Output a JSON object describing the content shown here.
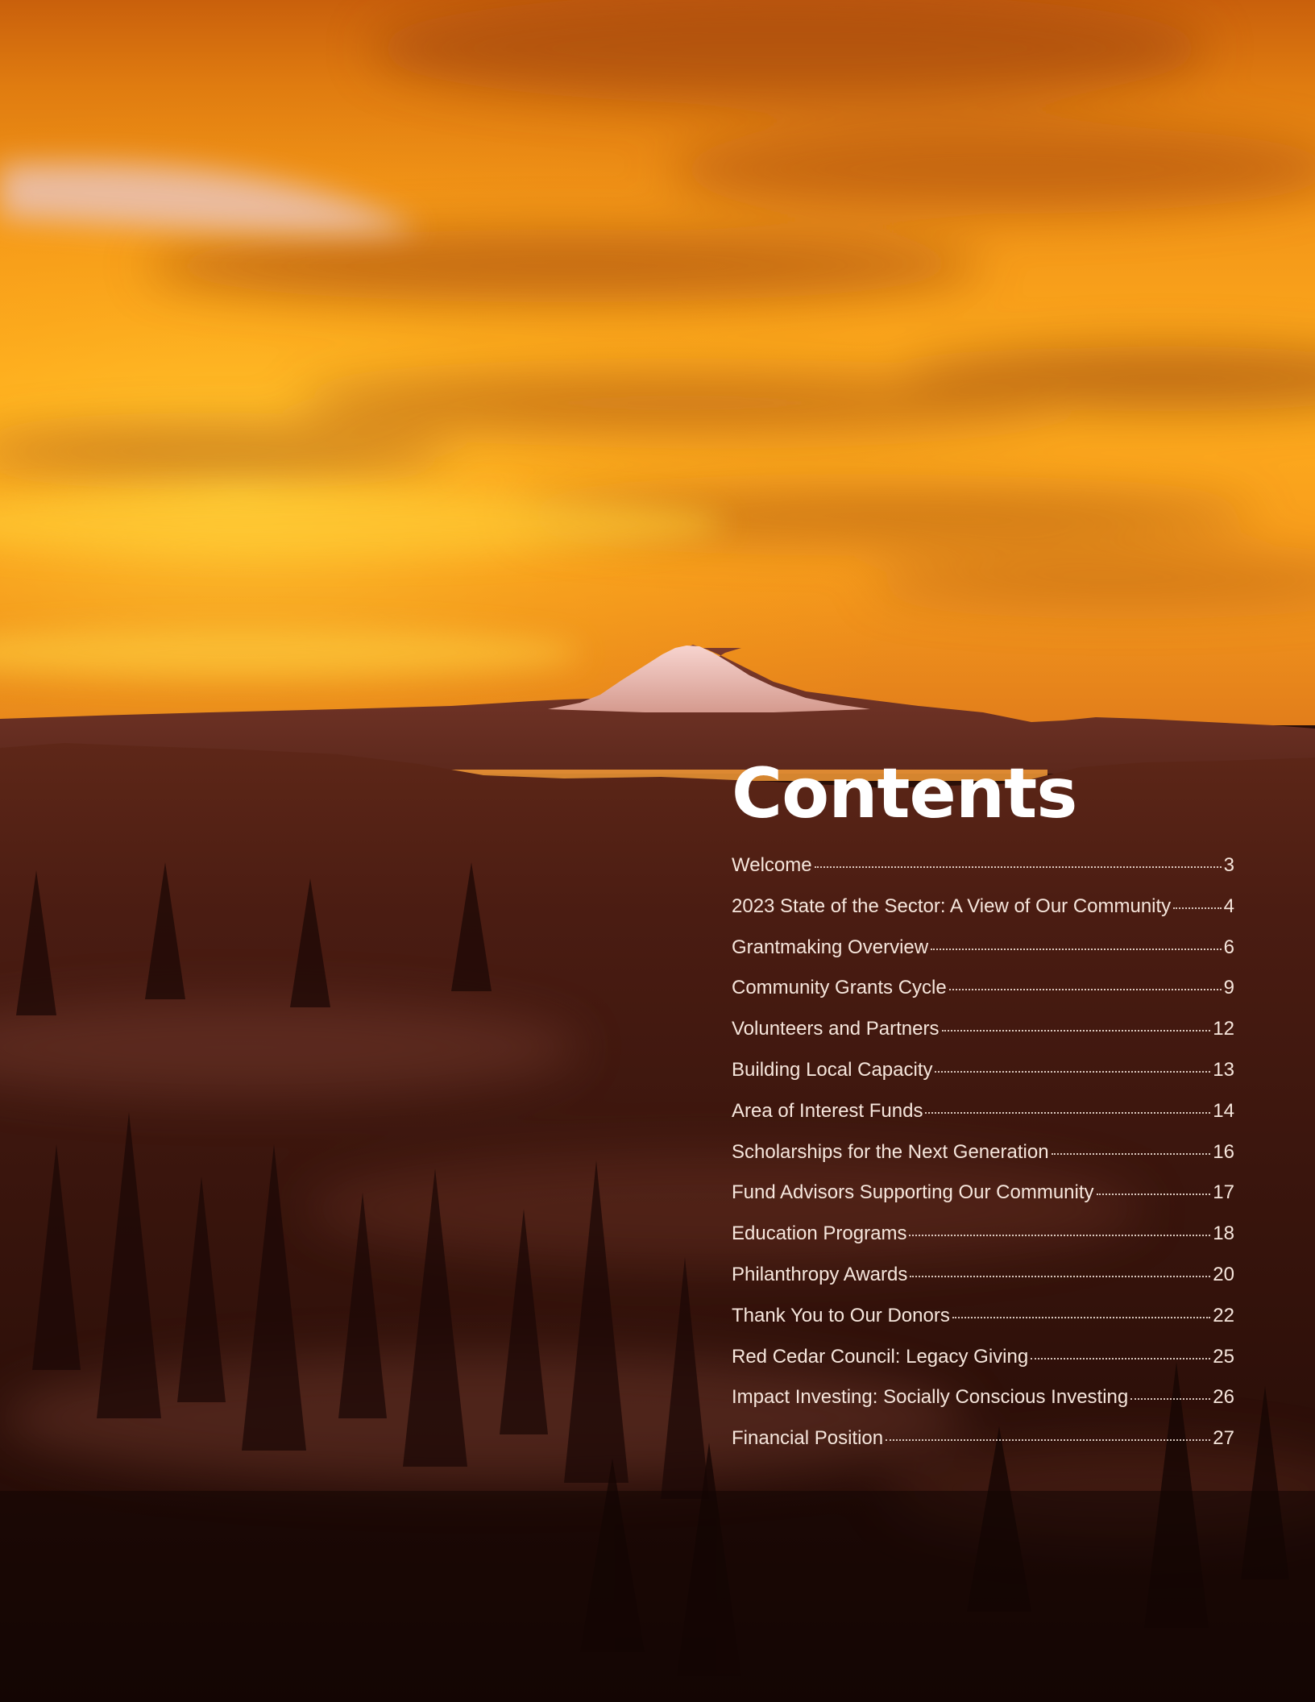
{
  "contents": {
    "title": "Contents",
    "entries": [
      {
        "label": "Welcome",
        "page": "3"
      },
      {
        "label": "2023 State of the Sector: A View of Our Community",
        "page": "4"
      },
      {
        "label": "Grantmaking Overview",
        "page": "6"
      },
      {
        "label": "Community Grants Cycle",
        "page": "9"
      },
      {
        "label": "Volunteers and Partners",
        "page": "12"
      },
      {
        "label": "Building Local Capacity",
        "page": "13"
      },
      {
        "label": "Area of Interest Funds",
        "page": "14"
      },
      {
        "label": "Scholarships for the Next Generation",
        "page": "16"
      },
      {
        "label": "Fund Advisors Supporting Our Community",
        "page": "17"
      },
      {
        "label": "Education Programs",
        "page": "18"
      },
      {
        "label": "Philanthropy Awards",
        "page": "20"
      },
      {
        "label": "Thank You to Our Donors",
        "page": "22"
      },
      {
        "label": "Red Cedar Council: Legacy Giving",
        "page": "25"
      },
      {
        "label": "Impact Investing: Socially Conscious Investing",
        "page": "26"
      },
      {
        "label": "Financial  Position",
        "page": "27"
      }
    ]
  },
  "colors": {
    "sky_top": "#d9730f",
    "sky_glow": "#ffb11c",
    "mountain_snow": "#f3c7c3",
    "forest_dark": "#2a0f08",
    "text": "#ffffff"
  }
}
